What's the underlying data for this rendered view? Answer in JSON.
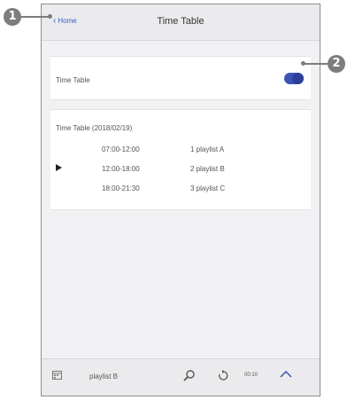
{
  "header": {
    "back_label": "Home",
    "title": "Time Table"
  },
  "toggle": {
    "label": "Time Table",
    "state": "on",
    "accent_color": "#3e53b5"
  },
  "schedule": {
    "title": "Time Table (2018/02/19)",
    "rows": [
      {
        "time": "07:00-12:00",
        "playlist": "1 playlist A",
        "current": false
      },
      {
        "time": "12:00-18:00",
        "playlist": "2 playlist B",
        "current": true
      },
      {
        "time": "18:00-21:30",
        "playlist": "3 playlist C",
        "current": false
      }
    ]
  },
  "bottom_bar": {
    "now_playing": "playlist B",
    "time": "00:10",
    "icons": [
      "calendar-icon",
      "search-icon",
      "repeat-icon",
      "chevron-up-icon"
    ]
  },
  "callouts": [
    "1",
    "2"
  ]
}
